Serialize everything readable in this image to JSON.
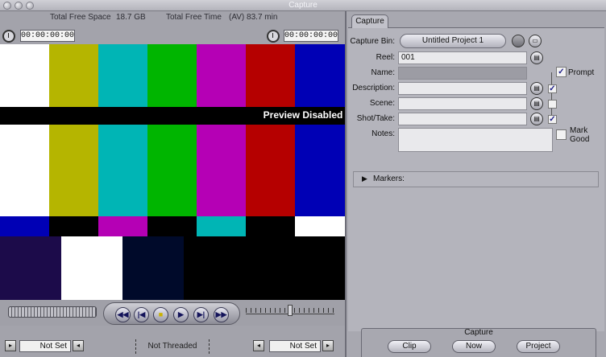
{
  "window": {
    "title": "Capture"
  },
  "viewer": {
    "free_space_label": "Total Free Space",
    "free_space_value": "18.7 GB",
    "free_time_label": "Total Free Time",
    "free_time_value": "(AV) 83.7 min",
    "tc_left": "00:00:00:00",
    "tc_right": "00:00:00:00",
    "preview_text": "Preview Disabled",
    "in_point": "Not Set",
    "out_point": "Not Set",
    "threaded_status": "Not Threaded"
  },
  "transport": {
    "rewind": "◀◀",
    "prev_edit": "|◀",
    "stop": "■",
    "play": "▶",
    "next_edit": "▶|",
    "fast_forward": "▶▶"
  },
  "panel": {
    "tab": "Capture",
    "capture_bin_label": "Capture Bin:",
    "capture_bin_value": "Untitled Project 1",
    "reel_label": "Reel:",
    "reel_value": "001",
    "prompt_label": "Prompt",
    "name_label": "Name:",
    "description_label": "Description:",
    "scene_label": "Scene:",
    "shot_label": "Shot/Take:",
    "notes_label": "Notes:",
    "mark_good_line1": "Mark",
    "mark_good_line2": "Good",
    "markers_label": "Markers:"
  },
  "capture": {
    "group_label": "Capture",
    "clip": "Clip",
    "now": "Now",
    "project": "Project"
  },
  "colors": {
    "white": "#ffffff",
    "yellow": "#b5b500",
    "cyan": "#00b5b5",
    "green": "#00b500",
    "magenta": "#b500b5",
    "red": "#b50000",
    "blue": "#0000b5",
    "navy": "#1c0b4a",
    "black": "#000000",
    "dark_blue": "#000a2a"
  }
}
